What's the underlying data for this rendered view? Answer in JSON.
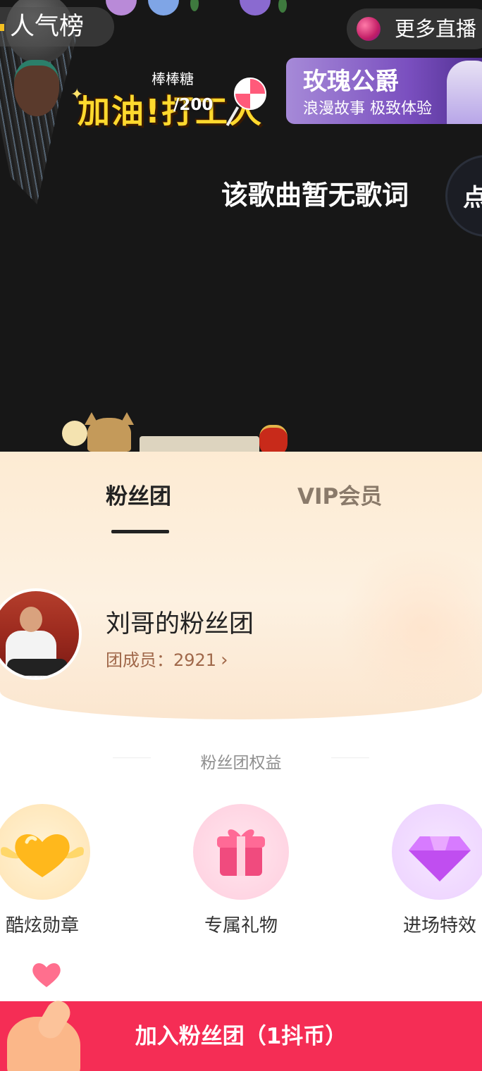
{
  "live": {
    "rank_label": "人气榜",
    "more_live_label": "更多直播",
    "task": {
      "title": "棒棒糖",
      "slogan": "加油!打工人",
      "progress": "/200"
    },
    "ad": {
      "title": "玫瑰公爵",
      "subtitle": "浪漫故事 极致体验"
    },
    "lyrics_text": "该歌曲暂无歌词",
    "song_button_label": "点"
  },
  "sheet": {
    "tabs": [
      {
        "label": "粉丝团",
        "active": true
      },
      {
        "label": "VIP会员",
        "active": false
      }
    ],
    "group_name": "刘哥的粉丝团",
    "member_label": "团成员：",
    "member_count": "2921",
    "benefits_title": "粉丝团权益",
    "benefits": [
      {
        "label": "酷炫勋章",
        "icon": "heart-medal-icon"
      },
      {
        "label": "专属礼物",
        "icon": "gift-icon"
      },
      {
        "label": "进场特效",
        "icon": "diamond-icon"
      }
    ],
    "join_button_label": "加入粉丝团（1抖币）"
  },
  "colors": {
    "join_button": "#f52d55",
    "header_bg": "#fdebd3",
    "member_text": "#a0684a"
  }
}
